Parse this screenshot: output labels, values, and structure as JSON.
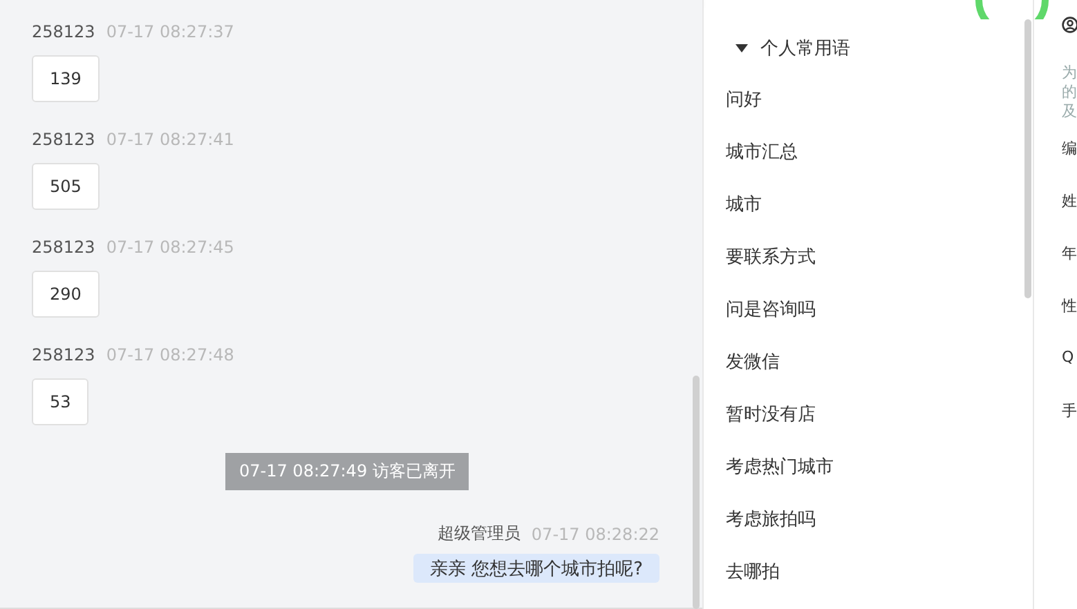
{
  "chat": {
    "messages": [
      {
        "kind": "visitor",
        "sender": "258123",
        "time": "07-17 08:27:37",
        "text": "139"
      },
      {
        "kind": "visitor",
        "sender": "258123",
        "time": "07-17 08:27:41",
        "text": "505"
      },
      {
        "kind": "visitor",
        "sender": "258123",
        "time": "07-17 08:27:45",
        "text": "290"
      },
      {
        "kind": "visitor",
        "sender": "258123",
        "time": "07-17 08:27:48",
        "text": "53"
      },
      {
        "kind": "system",
        "text": "07-17 08:27:49 访客已离开"
      },
      {
        "kind": "agent",
        "sender": "超级管理员",
        "time": "07-17 08:28:22",
        "text": "亲亲 您想去哪个城市拍呢?"
      }
    ]
  },
  "phrases": {
    "group": {
      "title": "个人常用语",
      "expanded": true,
      "items": [
        "问好",
        "城市汇总",
        "城市",
        "要联系方式",
        "问是咨询吗",
        "发微信",
        "暂时没有店",
        "考虑热门城市",
        "考虑旅拍吗",
        "去哪拍"
      ]
    }
  },
  "profile": {
    "note_lines": [
      "为",
      "的",
      "及"
    ],
    "fields": [
      "编",
      "姓",
      "年",
      "性",
      "Q",
      "手"
    ]
  }
}
